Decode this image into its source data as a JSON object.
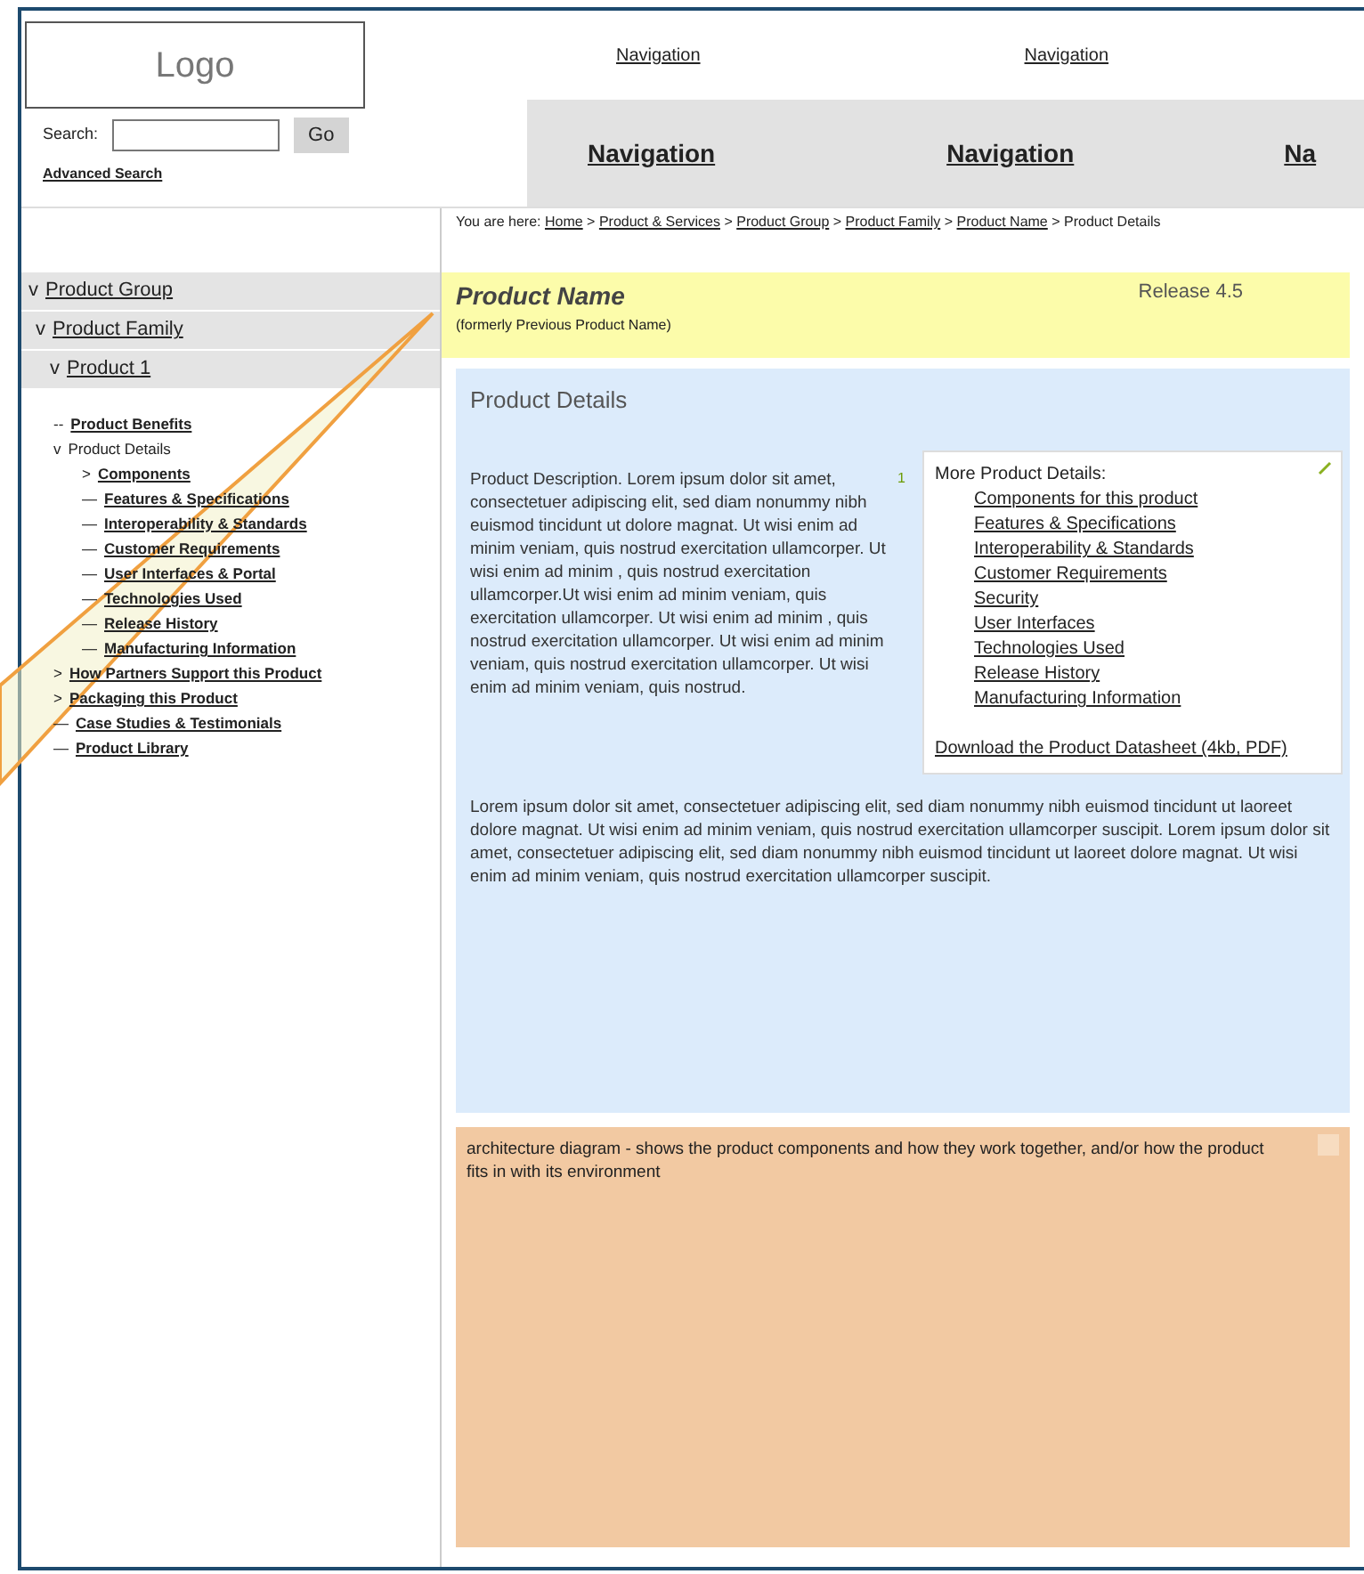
{
  "header": {
    "logo": "Logo",
    "top_nav": [
      "Navigation",
      "Navigation"
    ],
    "search": {
      "label": "Search:",
      "button": "Go",
      "advanced": "Advanced Search"
    },
    "main_nav": [
      "Navigation",
      "Navigation",
      "Na"
    ]
  },
  "breadcrumb": {
    "prefix": "You are here:",
    "items": [
      {
        "label": "Home",
        "link": true
      },
      {
        "label": "Product & Services",
        "link": true
      },
      {
        "label": "Product Group",
        "link": true
      },
      {
        "label": "Product Family",
        "link": true
      },
      {
        "label": "Product Name",
        "link": true
      },
      {
        "label": "Product Details",
        "link": false
      }
    ]
  },
  "sidebar": {
    "levels": [
      {
        "marker": "v",
        "label": "Product Group"
      },
      {
        "marker": "v",
        "label": "Product Family"
      },
      {
        "marker": "v",
        "label": "Product 1"
      }
    ],
    "tree": [
      {
        "marker": "--",
        "label": "Product Benefits",
        "link": true
      },
      {
        "marker": "v",
        "label": "Product Details",
        "link": false,
        "children": [
          {
            "marker": ">",
            "label": "Components",
            "link": true
          },
          {
            "marker": "—",
            "label": "Features & Specifications",
            "link": true
          },
          {
            "marker": "—",
            "label": "Interoperability & Standards",
            "link": true
          },
          {
            "marker": "—",
            "label": "Customer Requirements",
            "link": true
          },
          {
            "marker": "—",
            "label": "User Interfaces & Portal",
            "link": true
          },
          {
            "marker": "—",
            "label": "Technologies Used",
            "link": true
          },
          {
            "marker": "—",
            "label": "Release History",
            "link": true
          },
          {
            "marker": "—",
            "label": "Manufacturing Information",
            "link": true
          }
        ]
      },
      {
        "marker": ">",
        "label": "How Partners Support this Product",
        "link": true
      },
      {
        "marker": ">",
        "label": "Packaging this Product",
        "link": true
      },
      {
        "marker": "—",
        "label": "Case Studies & Testimonials",
        "link": true
      },
      {
        "marker": "—",
        "label": "Product Library",
        "link": true
      }
    ]
  },
  "product": {
    "name": "Product Name",
    "formerly": "(formerly Previous Product Name)",
    "release": "Release 4.5"
  },
  "details": {
    "title": "Product Details",
    "description": "Product Description.  Lorem ipsum dolor sit amet, consectetuer adipiscing elit, sed diam nonummy nibh euismod tincidunt ut dolore magnat. Ut wisi enim ad minim veniam, quis nostrud exercitation ullamcorper. Ut wisi enim ad minim , quis nostrud exercitation ullamcorper.Ut wisi enim ad minim veniam, quis exercitation ullamcorper. Ut wisi enim ad minim , quis nostrud exercitation ullamcorper.  Ut wisi enim ad minim veniam, quis nostrud exercitation ullamcorper. Ut wisi enim ad minim veniam, quis nostrud.",
    "note_mark": "1",
    "more": {
      "title": "More Product Details:",
      "links": [
        "Components for this product",
        "Features & Specifications",
        "Interoperability & Standards",
        "Customer Requirements",
        "Security",
        "User Interfaces",
        "Technologies Used",
        "Release History",
        "Manufacturing Information"
      ],
      "download": "Download the Product Datasheet (4kb, PDF)"
    },
    "paragraph": "Lorem ipsum dolor sit amet, consectetuer adipiscing elit, sed diam nonummy nibh euismod tincidunt ut laoreet dolore magnat. Ut wisi enim ad minim veniam, quis nostrud exercitation ullamcorper suscipit. Lorem ipsum dolor sit amet, consectetuer adipiscing elit, sed diam nonummy nibh euismod tincidunt ut laoreet dolore magnat. Ut wisi enim ad minim veniam, quis nostrud exercitation ullamcorper suscipit."
  },
  "architecture": {
    "text": "architecture diagram - shows the product components and how they work together, and/or how the product fits in with its environment"
  }
}
